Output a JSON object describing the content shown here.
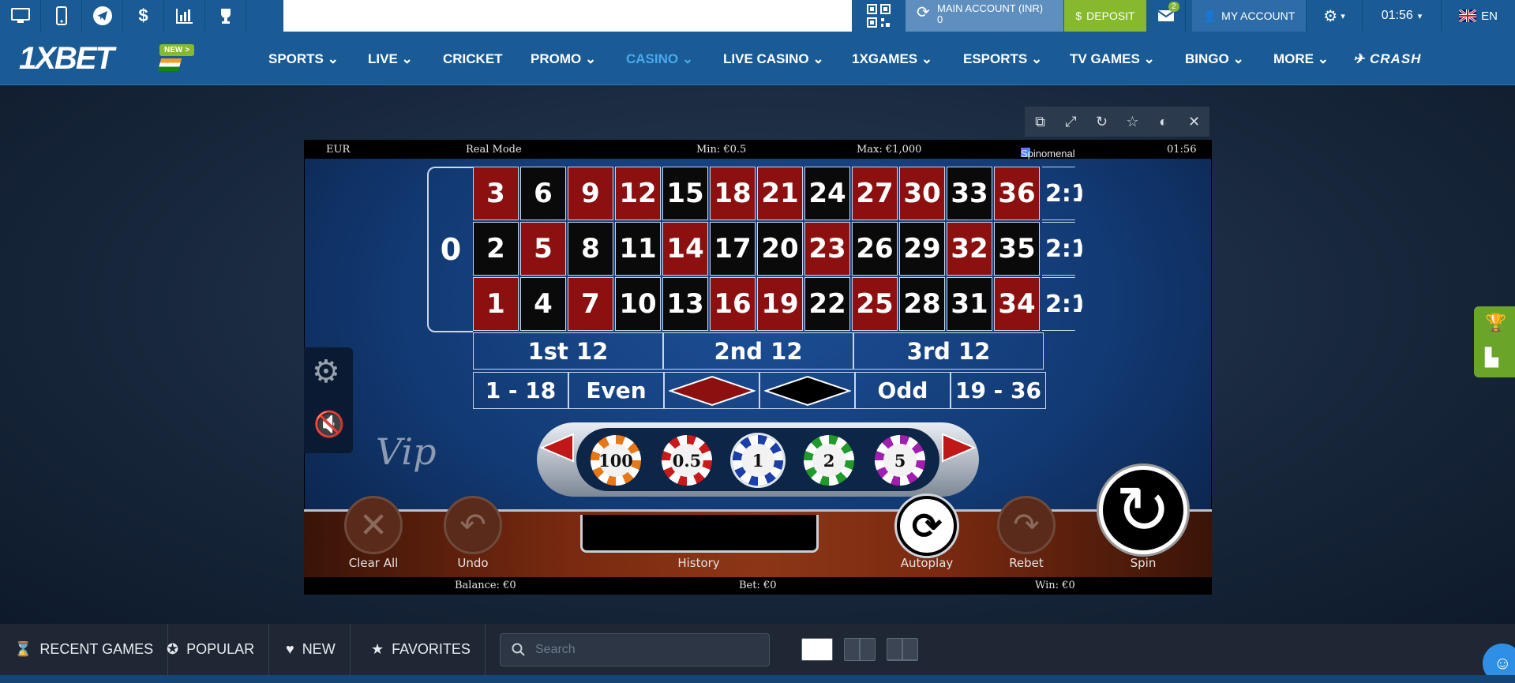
{
  "topbar": {
    "account_label": "MAIN ACCOUNT (INR)",
    "account_balance": "0",
    "deposit": "DEPOSIT",
    "mail_count": "2",
    "my_account": "MY ACCOUNT",
    "time": "01:56",
    "language": "EN"
  },
  "nav": {
    "logo": "1XBET",
    "new_badge": "NEW >",
    "items": [
      "SPORTS",
      "LIVE",
      "CRICKET",
      "PROMO",
      "CASINO",
      "LIVE CASINO",
      "1XGAMES",
      "ESPORTS",
      "TV GAMES",
      "BINGO",
      "MORE"
    ],
    "crash": "CRASH"
  },
  "game": {
    "currency": "EUR",
    "mode": "Real Mode",
    "min": "Min: €0.5",
    "max": "Max: €1,000",
    "provider": "Spinomenal",
    "clock": "01:56",
    "zero": "0",
    "rows": [
      [
        "3",
        "6",
        "9",
        "12",
        "15",
        "18",
        "21",
        "24",
        "27",
        "30",
        "33",
        "36"
      ],
      [
        "2",
        "5",
        "8",
        "11",
        "14",
        "17",
        "20",
        "23",
        "26",
        "29",
        "32",
        "35"
      ],
      [
        "1",
        "4",
        "7",
        "10",
        "13",
        "16",
        "19",
        "22",
        "25",
        "28",
        "31",
        "34"
      ]
    ],
    "row_colors": [
      [
        "red",
        "blk",
        "red",
        "red",
        "blk",
        "red",
        "red",
        "blk",
        "red",
        "red",
        "blk",
        "red"
      ],
      [
        "blk",
        "red",
        "blk",
        "blk",
        "red",
        "blk",
        "blk",
        "red",
        "blk",
        "blk",
        "red",
        "blk"
      ],
      [
        "red",
        "blk",
        "red",
        "blk",
        "blk",
        "red",
        "red",
        "blk",
        "red",
        "blk",
        "blk",
        "red"
      ]
    ],
    "column_bet": "2:1",
    "dozens": [
      "1st 12",
      "2nd 12",
      "3rd 12"
    ],
    "outside": {
      "low": "1 - 18",
      "even": "Even",
      "odd": "Odd",
      "high": "19 - 36"
    },
    "vip": "Vip",
    "chips": [
      "100",
      "0.5",
      "1",
      "2",
      "5"
    ],
    "buttons": {
      "clear": "Clear All",
      "undo": "Undo",
      "history": "History",
      "autoplay": "Autoplay",
      "rebet": "Rebet",
      "spin": "Spin"
    },
    "balance": "Balance: €0",
    "bet": "Bet: €0",
    "win": "Win: €0"
  },
  "bottombar": {
    "recent": "RECENT GAMES",
    "popular": "POPULAR",
    "new": "NEW",
    "favorites": "FAVORITES",
    "search_placeholder": "Search"
  },
  "colors": {
    "brand_blue": "#1a5b96",
    "deposit_green": "#86b92d",
    "roulette_red": "#8c1010",
    "active_nav": "#4aa8ee"
  }
}
